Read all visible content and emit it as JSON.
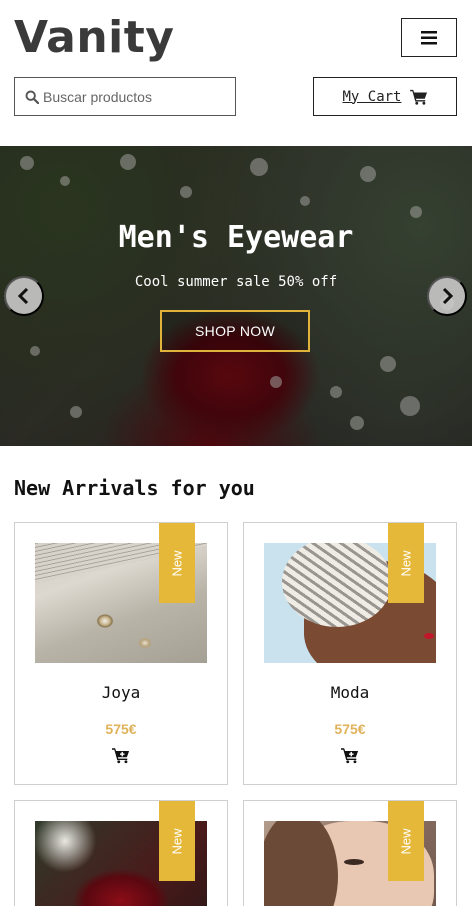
{
  "header": {
    "brand": "Vanity",
    "menu_icon": "hamburger-menu-icon",
    "search": {
      "placeholder": "Buscar productos",
      "value": "",
      "icon": "search-icon"
    },
    "cart": {
      "label": "My Cart",
      "icon": "shopping-cart-icon"
    }
  },
  "hero": {
    "title": "Men's Eyewear",
    "subtitle": "Cool summer sale 50% off",
    "button_label": "SHOP NOW",
    "prev_icon": "chevron-left-icon",
    "next_icon": "chevron-right-icon"
  },
  "section": {
    "title": "New Arrivals for you"
  },
  "products": [
    {
      "badge": "New",
      "name": "Joya",
      "price": "575€",
      "image": "rings-on-book-image"
    },
    {
      "badge": "New",
      "name": "Moda",
      "price": "575€",
      "image": "woman-braided-hair-image"
    },
    {
      "badge": "New",
      "name": "",
      "price": "",
      "image": "ring-on-rose-image"
    },
    {
      "badge": "New",
      "name": "",
      "price": "",
      "image": "woman-portrait-image"
    }
  ],
  "colors": {
    "accent": "#e6b83a",
    "price": "#e0b25a",
    "text": "#222222"
  }
}
